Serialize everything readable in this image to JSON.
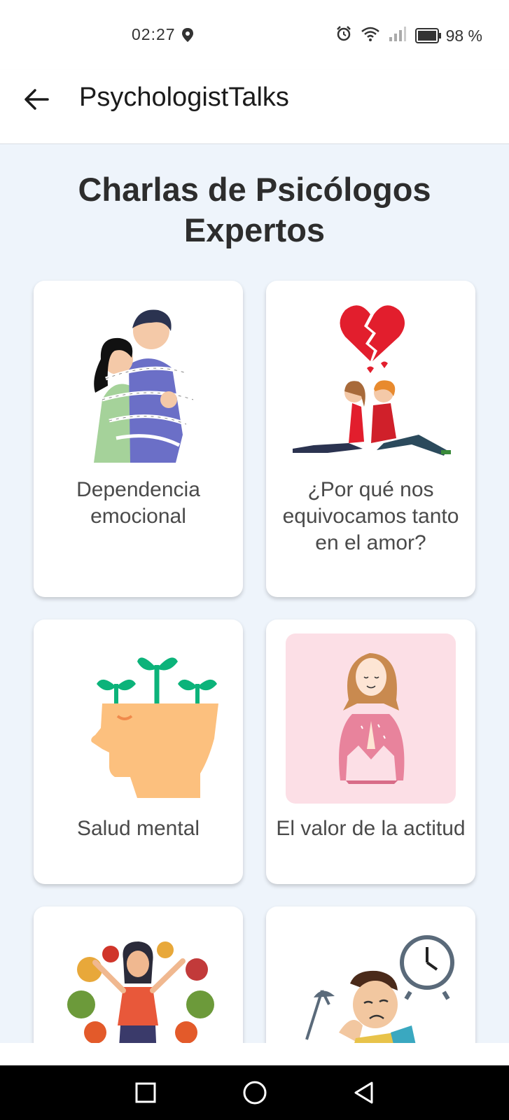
{
  "status": {
    "time": "02:27",
    "battery": "98 %"
  },
  "app_bar": {
    "title": "PsychologistTalks",
    "back_icon": "arrow-left-icon"
  },
  "main": {
    "title_line1": "Charlas de Psicólogos",
    "title_line2": "Expertos",
    "cards": [
      {
        "label": "Dependencia emocional",
        "image": "couple-barbed-wire-illustration"
      },
      {
        "label": "¿Por qué nos equivocamos tanto en el amor?",
        "image": "broken-heart-couple-illustration"
      },
      {
        "label": "Salud mental",
        "image": "head-with-sprouts-illustration"
      },
      {
        "label": "El valor de la actitud",
        "image": "grateful-woman-illustration"
      },
      {
        "label": "",
        "image": "healthy-food-woman-illustration"
      },
      {
        "label": "",
        "image": "tired-man-clock-illustration"
      }
    ]
  },
  "nav": {
    "recent_icon": "square-icon",
    "home_icon": "circle-icon",
    "back_icon": "triangle-back-icon"
  },
  "colors": {
    "background": "#eef4fb",
    "card": "#ffffff",
    "title_text": "#2d2d2d",
    "label_text": "#4a4a4a"
  }
}
